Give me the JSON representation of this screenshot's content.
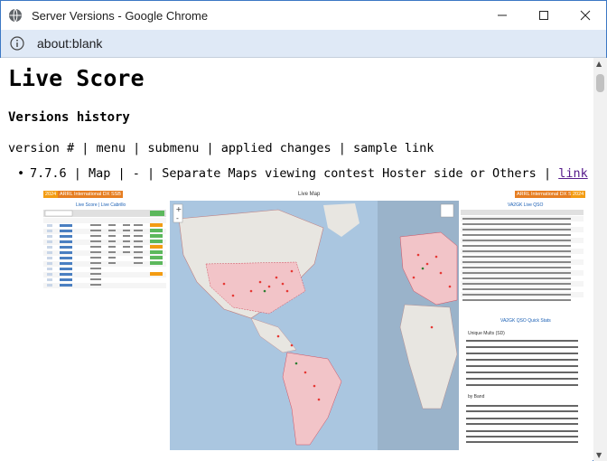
{
  "window": {
    "title": "Server Versions - Google Chrome",
    "url": "about:blank"
  },
  "page": {
    "heading": "Live Score",
    "subheading": "Versions history",
    "columns_line": "version # | menu | submenu | applied changes | sample link",
    "entries": [
      {
        "text": "7.7.6 | Map | - | Separate Maps viewing contest Hoster side or Others | ",
        "link_label": "link"
      }
    ]
  },
  "sample_image": {
    "left_badge_year": "2024",
    "left_badge_contest": "ARRL International DX SSB",
    "right_badge_contest": "ARRL International DX SSB",
    "right_badge_year": "2024",
    "left_title": "Live Score | Live Cabrillo",
    "map_title": "Live Map",
    "right_title": "VA2GK Live QSO",
    "stats_title": "VA2GK QSO Quick Stats",
    "unique_label": "Unique Mults (SD)",
    "band_label": "by Band"
  },
  "colors": {
    "chrome_accent": "#3c78c4",
    "address_bar": "#dfe9f6",
    "link_visited": "#551a8b",
    "badge_orange": "#f39c12"
  }
}
